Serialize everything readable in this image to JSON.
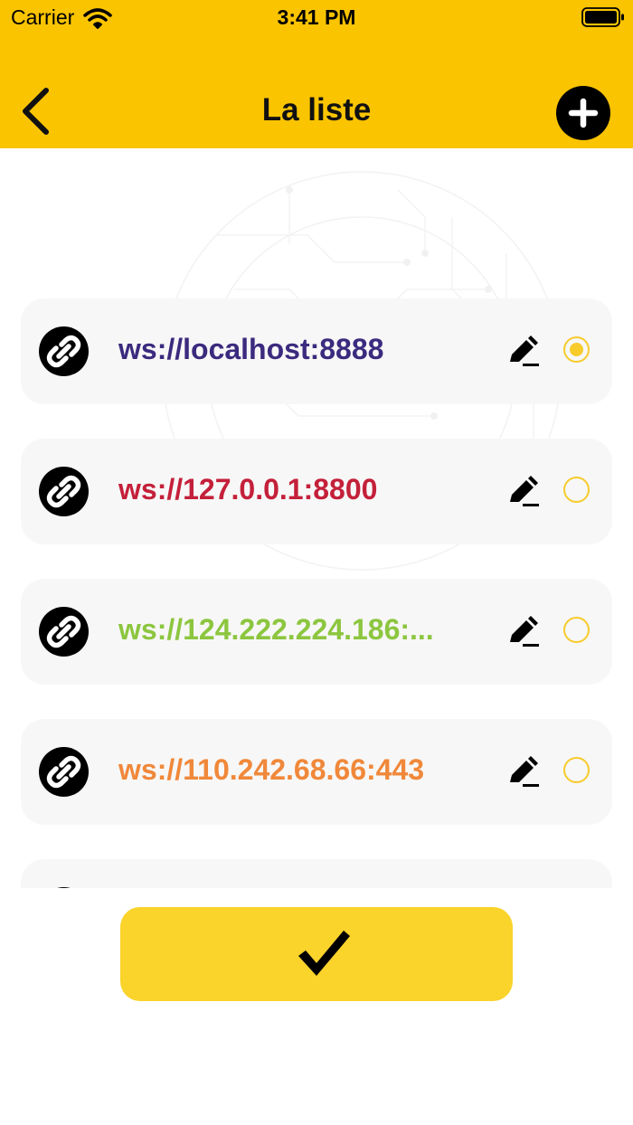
{
  "status_bar": {
    "carrier": "Carrier",
    "time": "3:41 PM",
    "icons": [
      "wifi-icon",
      "battery-icon"
    ]
  },
  "nav": {
    "title": "La liste",
    "back_icon": "chevron-left-icon",
    "add_icon": "plus-circle-icon"
  },
  "servers": [
    {
      "url": "ws://localhost:8888",
      "color": "#3B2A7E",
      "selected": true
    },
    {
      "url": "ws://127.0.0.1:8800",
      "color": "#C4203A",
      "selected": false
    },
    {
      "url": "ws://124.222.224.186:...",
      "color": "#8CC63F",
      "selected": false
    },
    {
      "url": "ws://110.242.68.66:443",
      "color": "#F0883A",
      "selected": false
    }
  ],
  "row_icons": {
    "link": "link-icon",
    "edit": "pencil-icon",
    "radio": "radio-button"
  },
  "confirm_icon": "checkmark-icon",
  "colors": {
    "header": "#FAC400",
    "accent": "#F7CB2A",
    "button": "#FAD32B",
    "row_bg": "#F7F7F7"
  }
}
